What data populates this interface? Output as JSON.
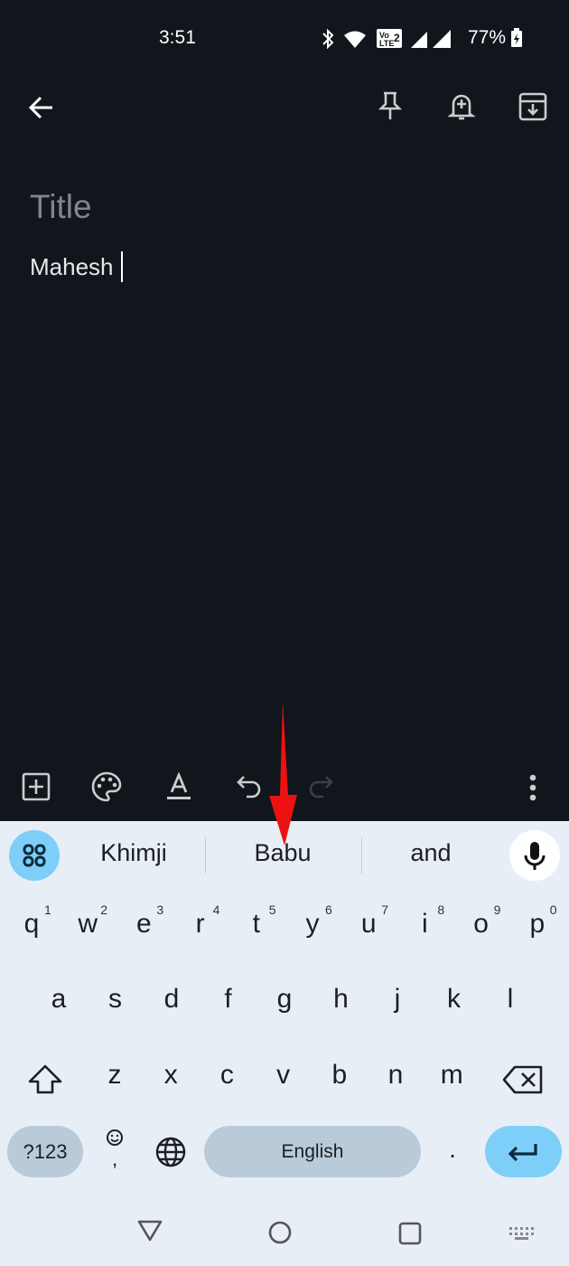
{
  "status_bar": {
    "time": "3:51",
    "battery": "77%",
    "icons": [
      "bluetooth-icon",
      "wifi-icon",
      "volte-icon",
      "signal-roaming-icon",
      "signal-icon",
      "battery-charging-icon"
    ],
    "volte_label": "Vo LTE 2"
  },
  "toolbar": {
    "icons": [
      "back-arrow-icon",
      "pin-icon",
      "reminder-bell-icon",
      "archive-icon"
    ]
  },
  "note": {
    "title_placeholder": "Title",
    "body": "Mahesh"
  },
  "editor_toolbar": {
    "icons": [
      "add-box-icon",
      "palette-icon",
      "text-format-icon",
      "undo-icon",
      "redo-icon",
      "more-vert-icon"
    ]
  },
  "keyboard": {
    "suggestions": [
      "Khimji",
      "Babu",
      "and"
    ],
    "row1": [
      {
        "k": "q",
        "h": "1"
      },
      {
        "k": "w",
        "h": "2"
      },
      {
        "k": "e",
        "h": "3"
      },
      {
        "k": "r",
        "h": "4"
      },
      {
        "k": "t",
        "h": "5"
      },
      {
        "k": "y",
        "h": "6"
      },
      {
        "k": "u",
        "h": "7"
      },
      {
        "k": "i",
        "h": "8"
      },
      {
        "k": "o",
        "h": "9"
      },
      {
        "k": "p",
        "h": "0"
      }
    ],
    "row2": [
      "a",
      "s",
      "d",
      "f",
      "g",
      "h",
      "j",
      "k",
      "l"
    ],
    "row3": [
      "z",
      "x",
      "c",
      "v",
      "b",
      "n",
      "m"
    ],
    "symbols_label": "?123",
    "emoji_hint": ",",
    "space_label": "English",
    "period": ".",
    "accent": "#7dcff9"
  },
  "annotation": {
    "arrow_color": "#ee1111"
  }
}
